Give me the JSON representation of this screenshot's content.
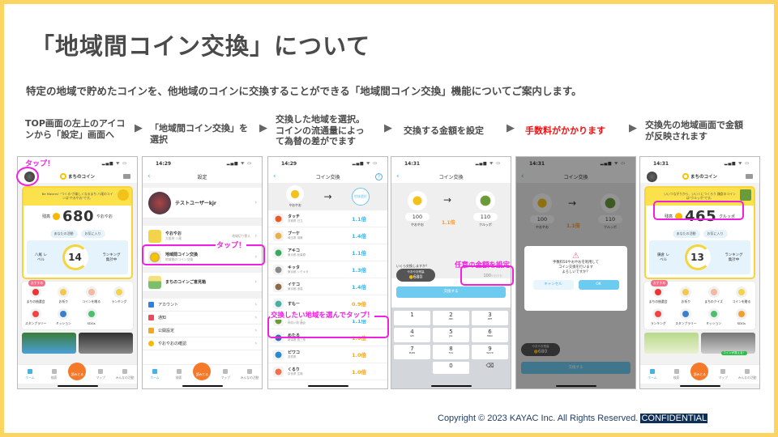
{
  "slide": {
    "title": "「地域間コイン交換」について",
    "subtitle": "特定の地域で貯めたコインを、他地域のコインに交換することができる「地域間コイン交換」機能についてご案内します。",
    "arrow": "▶",
    "steps": [
      {
        "text": "TOP画面の左上のアイコンから「設定」画面へ"
      },
      {
        "text": "「地域間コイン交換」を選択"
      },
      {
        "text": "交換した地域を選択。コインの流通量によって為替の差がでます"
      },
      {
        "text": "交換する金額を設定"
      },
      {
        "text": "手数料がかかります",
        "color": "#f01010"
      },
      {
        "text": "交換先の地域画面で金額が反映されます"
      }
    ],
    "copyright": "Copyright © 2023 KAYAC Inc. All Rights Reserved.",
    "confidential": "CONFIDENTIAL",
    "colors": {
      "border": "#fcd462",
      "highlight": "#f020e0",
      "accent": "#4ab0e8",
      "coin": "#f8b800"
    }
  },
  "app": {
    "logo": "まちのコイン",
    "nav": [
      "ホーム",
      "検索",
      "読みとる",
      "マップ",
      "みんなの活動"
    ],
    "active": "あなたの活動",
    "favorite": "お気に入り",
    "ranking": "ランキング\n集計中",
    "recommended": "おすすめ"
  },
  "phone1": {
    "tap": "タップ！",
    "banner": "Be Makers! \"つくる\"が楽しくなるまち 八尾のコインは\"やおやお\"です。",
    "balance_label": "残高",
    "balance": "680",
    "unit": "やおやお",
    "level_label": "八尾 レベル",
    "level": "14",
    "menu": [
      "まちの抽選会",
      "お祈り",
      "コインを贈る",
      "ランキング",
      "スタンプラリー",
      "ミッション",
      "SDGs"
    ]
  },
  "phone2": {
    "time": "14:29",
    "title": "設定",
    "user": "テストユーザーkjr",
    "region": "やおやお",
    "region_sub": "大阪府 八尾",
    "region_switch": "地域切り替え",
    "exchange": "地域間コイン交換",
    "exchange_sub": "地域間のコイン交換",
    "feedback": "まちのコインご意見箱",
    "items": [
      "アカウント",
      "通知",
      "公開設定",
      "やおやおの確認"
    ],
    "tap": "タップ！"
  },
  "phone3": {
    "time": "14:29",
    "title": "コイン交換",
    "from": "やおやお",
    "select": "地域選択",
    "tap": "交換したい地域を選んでタップ！",
    "coins": [
      {
        "name": "タッチ",
        "place": "茨城県 日立",
        "rate": "1.1倍"
      },
      {
        "name": "ブーケ",
        "place": "埼玉県 鴻巣",
        "rate": "1.4倍"
      },
      {
        "name": "アキコ",
        "place": "東京都 秋葉原",
        "rate": "1.1倍"
      },
      {
        "name": "キッタ",
        "place": "東京都 シモキタ",
        "rate": "1.3倍"
      },
      {
        "name": "イケコ",
        "place": "東京都 池袋",
        "rate": "1.4倍"
      },
      {
        "name": "すもー",
        "place": "",
        "rate": "0.9倍"
      },
      {
        "name": "クルッポ",
        "place": "神奈川県 鎌倉",
        "rate": "1.1倍"
      },
      {
        "name": "めたる",
        "place": "新潟県 燕三条",
        "rate": "1.0倍"
      },
      {
        "name": "ビワコ",
        "place": "滋賀県",
        "rate": "1.0倍"
      },
      {
        "name": "くるり",
        "place": "奈良県 生駒",
        "rate": "1.0倍"
      }
    ]
  },
  "phone4": {
    "time": "14:31",
    "title": "コイン交換",
    "from_amount": "100",
    "from": "やおやお",
    "rate": "1.1倍",
    "to_amount": "110",
    "to": "クルッポ",
    "question": "いくら交換しますか？",
    "balance_label": "やおやお残高",
    "balance": "680",
    "input": "100",
    "input_unit": "やおやお",
    "button": "交換する",
    "tap": "任意の金額を設定",
    "keys": [
      [
        "1",
        ""
      ],
      [
        "2",
        "ABC"
      ],
      [
        "3",
        "DEF"
      ],
      [
        "4",
        "GHI"
      ],
      [
        "5",
        "JKL"
      ],
      [
        "6",
        "MNO"
      ],
      [
        "7",
        "PQRS"
      ],
      [
        "8",
        "TUV"
      ],
      [
        "9",
        "WXYZ"
      ],
      [
        "",
        ""
      ],
      [
        "0",
        ""
      ],
      [
        "⌫",
        ""
      ]
    ]
  },
  "phone5": {
    "time": "14:31",
    "title": "コイン交換",
    "dialog": [
      "手数料50やおやおを利用して",
      "コイン交換を行います",
      "よろしいですか？"
    ],
    "cancel": "キャンセル",
    "ok": "OK",
    "balance_label": "やおやお残高",
    "balance": "680",
    "button": "交換する"
  },
  "phone6": {
    "time": "14:31",
    "banner": "いいつながりから、いいくにつくろう 鎌倉のコインは\"クルッポ\"です。",
    "balance_label": "残高",
    "balance": "465",
    "unit": "クルッポ",
    "level_label": "鎌倉 レベル",
    "level": "13",
    "menu": [
      "まちの抽選会",
      "お祈り",
      "まちのクイズ",
      "コインを贈る",
      "ランキング",
      "スタンプラリー",
      "ミッション",
      "SDGs"
    ],
    "coin_badge": "コインが貰える！"
  }
}
